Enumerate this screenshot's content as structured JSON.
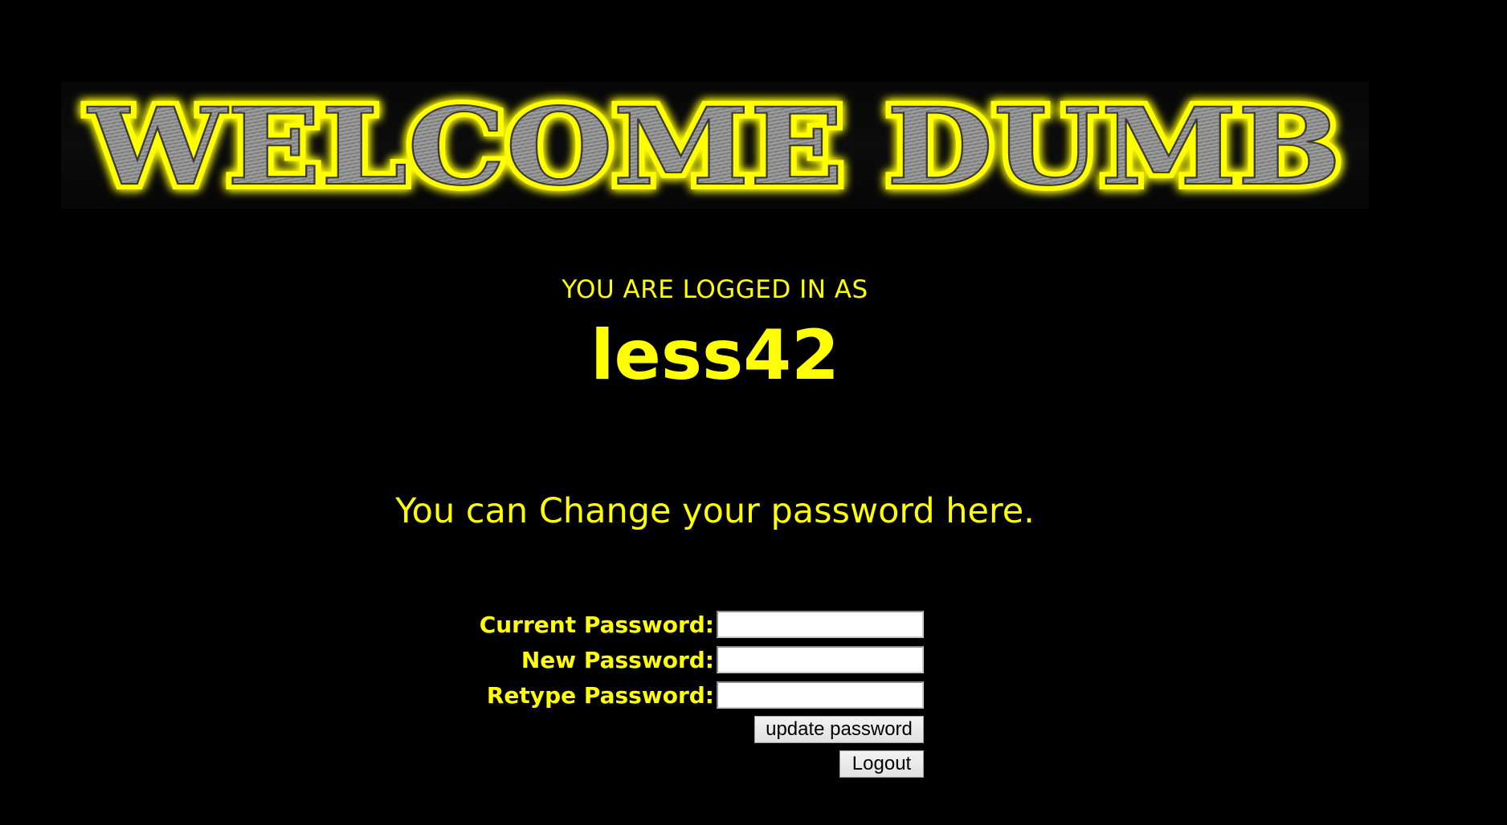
{
  "banner": {
    "text": "WELCOME DUMB"
  },
  "session": {
    "caption": "YOU ARE LOGGED IN AS",
    "username": "less42"
  },
  "change_password": {
    "message": "You can Change your password here.",
    "fields": [
      {
        "label": "Current Password:",
        "value": ""
      },
      {
        "label": "New Password:",
        "value": ""
      },
      {
        "label": "Retype Password:",
        "value": ""
      }
    ],
    "submit_label": "update password"
  },
  "logout_label": "Logout",
  "colors": {
    "background": "#000000",
    "text": "#ffff00",
    "logo_fill": "#8c8c8c",
    "logo_glow": "#ffff00"
  }
}
